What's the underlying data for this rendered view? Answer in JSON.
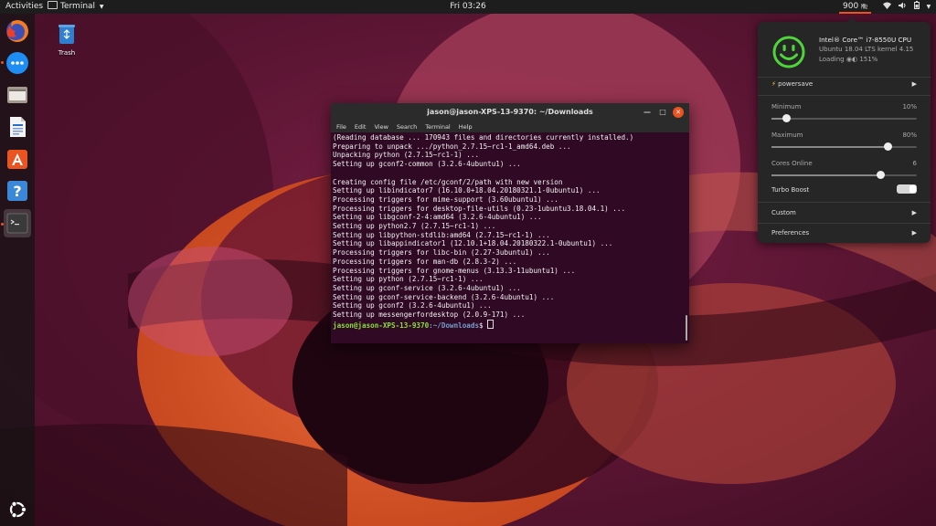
{
  "topbar": {
    "activities": "Activities",
    "app_menu": "Terminal",
    "clock": "Fri 03:26",
    "cpu_freq": "900",
    "cpu_freq_unit": "㎒"
  },
  "desktop": {
    "trash_label": "Trash"
  },
  "terminal": {
    "title": "jason@jason-XPS-13-9370: ~/Downloads",
    "menu": [
      "File",
      "Edit",
      "View",
      "Search",
      "Terminal",
      "Help"
    ],
    "lines": [
      "(Reading database ... 170943 files and directories currently installed.)",
      "Preparing to unpack .../python_2.7.15~rc1-1_amd64.deb ...",
      "Unpacking python (2.7.15~rc1-1) ...",
      "Setting up gconf2-common (3.2.6-4ubuntu1) ...",
      "",
      "Creating config file /etc/gconf/2/path with new version",
      "Setting up libindicator7 (16.10.0+18.04.20180321.1-0ubuntu1) ...",
      "Processing triggers for mime-support (3.60ubuntu1) ...",
      "Processing triggers for desktop-file-utils (0.23-1ubuntu3.18.04.1) ...",
      "Setting up libgconf-2-4:amd64 (3.2.6-4ubuntu1) ...",
      "Setting up python2.7 (2.7.15~rc1-1) ...",
      "Setting up libpython-stdlib:amd64 (2.7.15~rc1-1) ...",
      "Setting up libappindicator1 (12.10.1+18.04.20180322.1-0ubuntu1) ...",
      "Processing triggers for libc-bin (2.27-3ubuntu1) ...",
      "Processing triggers for man-db (2.8.3-2) ...",
      "Processing triggers for gnome-menus (3.13.3-11ubuntu1) ...",
      "Setting up python (2.7.15~rc1-1) ...",
      "Setting up gconf-service (3.2.6-4ubuntu1) ...",
      "Setting up gconf-service-backend (3.2.6-4ubuntu1) ...",
      "Setting up gconf2 (3.2.6-4ubuntu1) ...",
      "Setting up messengerfordesktop (2.0.9-171) ..."
    ],
    "prompt_user": "jason@jason-XPS-13-9370",
    "prompt_path": ":~/Downloads",
    "prompt_symbol": "$ "
  },
  "cpu_panel": {
    "cpu_name": "Intel® Core™ i7-8550U CPU",
    "os_info": "Ubuntu 18.04 LTS kernel 4.15",
    "load_label": "Loading",
    "load_value": "151%",
    "governor": "powersave",
    "minimum_label": "Minimum",
    "minimum_value": "10%",
    "minimum_level": 0.1,
    "maximum_label": "Maximum",
    "maximum_value": "80%",
    "maximum_level": 0.8,
    "cores_label": "Cores Online",
    "cores_value": "6",
    "cores_level": 0.75,
    "turbo_label": "Turbo Boost",
    "turbo_on": true,
    "custom_label": "Custom",
    "preferences_label": "Preferences"
  },
  "colors": {
    "accent": "#e95420",
    "terminal_bg": "#300a24",
    "smiley": "#4dd53a"
  }
}
